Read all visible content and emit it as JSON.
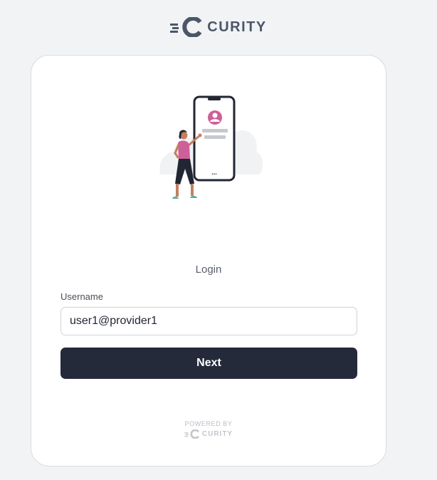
{
  "brand": {
    "name": "CURITY",
    "color": "#4b5669"
  },
  "login": {
    "title": "Login",
    "username_label": "Username",
    "username_value": "user1@provider1",
    "next_label": "Next",
    "button_color": "#252a3a"
  },
  "footer": {
    "powered_by": "POWERED BY",
    "brand": "CURITY"
  },
  "illustration": {
    "icon": "person-holding-phone-illustration",
    "phone_dots": "..."
  }
}
